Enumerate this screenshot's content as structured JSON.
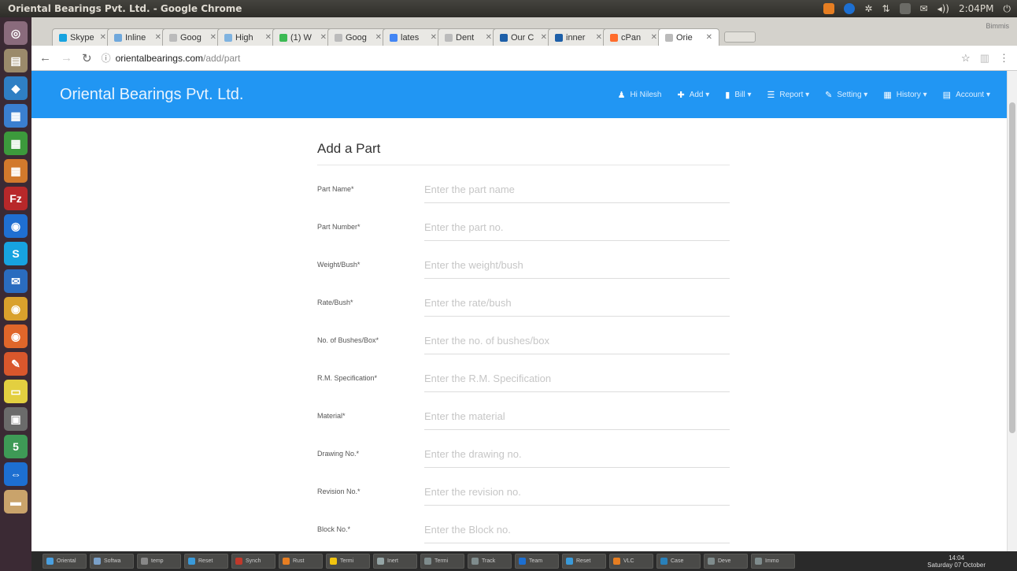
{
  "os_panel": {
    "window_title": "Oriental Bearings Pvt. Ltd. - Google Chrome",
    "clock": "2:04PM"
  },
  "launcher": {
    "items": [
      {
        "name": "dash-icon",
        "glyph": "◎",
        "color": "#8a6b7c"
      },
      {
        "name": "files-icon",
        "glyph": "▤",
        "color": "#9b8a6b"
      },
      {
        "name": "box-icon",
        "glyph": "◆",
        "color": "#2f7fc4"
      },
      {
        "name": "writer-icon",
        "glyph": "▦",
        "color": "#3a7fd0"
      },
      {
        "name": "calc-icon",
        "glyph": "▦",
        "color": "#3c9a3c"
      },
      {
        "name": "impress-icon",
        "glyph": "▦",
        "color": "#d2792c"
      },
      {
        "name": "filezilla-icon",
        "glyph": "Fz",
        "color": "#b8282a"
      },
      {
        "name": "teamviewer-icon",
        "glyph": "◉",
        "color": "#1f6fd1"
      },
      {
        "name": "skype-icon",
        "glyph": "S",
        "color": "#17a3e0"
      },
      {
        "name": "thunderbird-icon",
        "glyph": "✉",
        "color": "#2a6cbf"
      },
      {
        "name": "chrome-icon",
        "glyph": "◉",
        "color": "#d9a12c"
      },
      {
        "name": "firefox-icon",
        "glyph": "◉",
        "color": "#e0662a"
      },
      {
        "name": "editor-icon",
        "glyph": "✎",
        "color": "#d9572c"
      },
      {
        "name": "notes-icon",
        "glyph": "▭",
        "color": "#e3cf40"
      },
      {
        "name": "monitor-icon",
        "glyph": "▣",
        "color": "#6b6b6b"
      },
      {
        "name": "calendar-icon",
        "glyph": "5",
        "color": "#3e9a56"
      },
      {
        "name": "teamviewer2-icon",
        "glyph": "⇔",
        "color": "#1d6fd1"
      },
      {
        "name": "trash-icon",
        "glyph": "▬",
        "color": "#c9a36b"
      }
    ]
  },
  "browser": {
    "tabs": [
      {
        "label": "Skype",
        "color": "#17a3e0"
      },
      {
        "label": "Inline",
        "color": "#6fa8dc"
      },
      {
        "label": "Goog",
        "color": "#bbbbbb"
      },
      {
        "label": "High",
        "color": "#7fb3e0"
      },
      {
        "label": "(1) W",
        "color": "#3cba54"
      },
      {
        "label": "Goog",
        "color": "#bbbbbb"
      },
      {
        "label": "lates",
        "color": "#4285f4"
      },
      {
        "label": "Dent",
        "color": "#bbbbbb"
      },
      {
        "label": "Our C",
        "color": "#1d5fa8"
      },
      {
        "label": "inner",
        "color": "#1d5fa8"
      },
      {
        "label": "cPan",
        "color": "#ff6c2c"
      },
      {
        "label": "Orie",
        "color": "#bbbbbb"
      }
    ],
    "profile_label": "Bimmis",
    "url_host": "orientalbearings.com",
    "url_path": "/add/part"
  },
  "app": {
    "brand": "Oriental Bearings Pvt. Ltd.",
    "menu": [
      {
        "name": "menu-user",
        "icon": "♟",
        "label": "Hi Nilesh"
      },
      {
        "name": "menu-add",
        "icon": "✚",
        "label": "Add ▾"
      },
      {
        "name": "menu-bill",
        "icon": "▮",
        "label": "Bill ▾"
      },
      {
        "name": "menu-report",
        "icon": "☰",
        "label": "Report ▾"
      },
      {
        "name": "menu-setting",
        "icon": "✎",
        "label": "Setting ▾"
      },
      {
        "name": "menu-history",
        "icon": "▦",
        "label": "History ▾"
      },
      {
        "name": "menu-account",
        "icon": "▤",
        "label": "Account ▾"
      }
    ]
  },
  "form": {
    "title": "Add a Part",
    "fields": [
      {
        "name": "part-name-field",
        "label": "Part Name*",
        "placeholder": "Enter the part name",
        "value": ""
      },
      {
        "name": "part-number-field",
        "label": "Part Number*",
        "placeholder": "Enter the part no.",
        "value": ""
      },
      {
        "name": "weight-bush-field",
        "label": "Weight/Bush*",
        "placeholder": "Enter the weight/bush",
        "value": ""
      },
      {
        "name": "rate-bush-field",
        "label": "Rate/Bush*",
        "placeholder": "Enter the rate/bush",
        "value": ""
      },
      {
        "name": "bushes-box-field",
        "label": "No. of Bushes/Box*",
        "placeholder": "Enter the no. of bushes/box",
        "value": ""
      },
      {
        "name": "rm-spec-field",
        "label": "R.M. Specification*",
        "placeholder": "Enter the R.M. Specification",
        "value": ""
      },
      {
        "name": "material-field",
        "label": "Material*",
        "placeholder": "Enter the material",
        "value": ""
      },
      {
        "name": "drawing-no-field",
        "label": "Drawing No.*",
        "placeholder": "Enter the drawing no.",
        "value": ""
      },
      {
        "name": "revision-no-field",
        "label": "Revision No.*",
        "placeholder": "Enter the revision no.",
        "value": ""
      },
      {
        "name": "block-no-field",
        "label": "Block No.*",
        "placeholder": "Enter the Block no.",
        "value": ""
      }
    ]
  },
  "taskbar": {
    "items": [
      {
        "label": "Oriental",
        "color": "#4aa0e0"
      },
      {
        "label": "Softwa",
        "color": "#7aa0c8"
      },
      {
        "label": "temp",
        "color": "#888888"
      },
      {
        "label": "Reset",
        "color": "#3a9ad9"
      },
      {
        "label": "Synch",
        "color": "#c0392b"
      },
      {
        "label": "Rust",
        "color": "#e67e22"
      },
      {
        "label": "Termi",
        "color": "#f1c40f"
      },
      {
        "label": "Inert",
        "color": "#95a5a6"
      },
      {
        "label": "Termi",
        "color": "#7f8c8d"
      },
      {
        "label": "Track",
        "color": "#7f8c8d"
      },
      {
        "label": "Team",
        "color": "#1d6fd1"
      },
      {
        "label": "Reset",
        "color": "#3a9ad9"
      },
      {
        "label": "VLC",
        "color": "#e67e22"
      },
      {
        "label": "Case",
        "color": "#2980b9"
      },
      {
        "label": "Deve",
        "color": "#7f8c8d"
      },
      {
        "label": "Immo",
        "color": "#7f8c8d"
      }
    ],
    "clock_time": "14:04",
    "clock_date": "Saturday 07 October"
  }
}
